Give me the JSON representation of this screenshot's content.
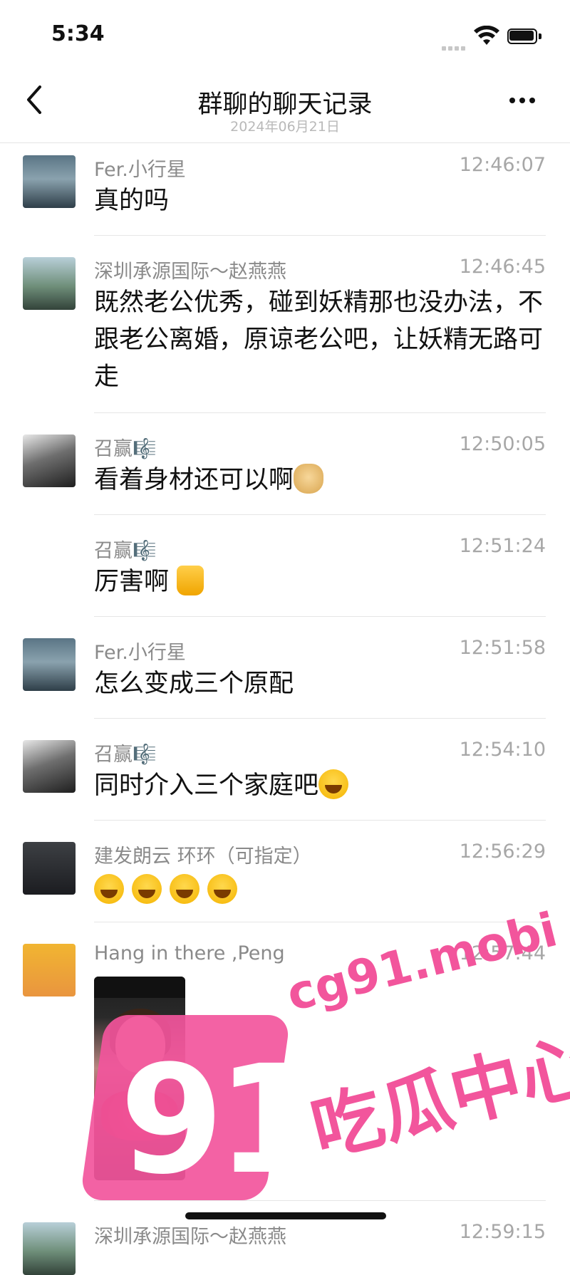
{
  "status_bar": {
    "time": "5:34"
  },
  "nav": {
    "title": "群聊的聊天记录",
    "subtitle": "2024年06月21日"
  },
  "messages": [
    {
      "sender": "Fer.小行星",
      "time": "12:46:07",
      "text": "真的吗",
      "avatar": "avatar-fer"
    },
    {
      "sender": "深圳承源国际～赵燕燕",
      "time": "12:46:45",
      "text": "既然老公优秀，碰到妖精那也没办法，不跟老公离婚，原谅老公吧，让妖精无路可走",
      "avatar": "avatar-shenzhen"
    },
    {
      "sender": "召赢🎼",
      "time": "12:50:05",
      "text": "看着身材还可以啊",
      "emoji": "doge-emoji",
      "avatar": "avatar-zhaoying"
    },
    {
      "sender": "召赢🎼",
      "time": "12:51:24",
      "text": "厉害啊",
      "emoji": "thumbs-up-emoji"
    },
    {
      "sender": "Fer.小行星",
      "time": "12:51:58",
      "text": "怎么变成三个原配",
      "avatar": "avatar-fer"
    },
    {
      "sender": "召赢🎼",
      "time": "12:54:10",
      "text": "同时介入三个家庭吧",
      "emoji": "laughing-emoji",
      "avatar": "avatar-zhaoying"
    },
    {
      "sender": "建发朗云 环环（可指定）",
      "time": "12:56:29",
      "text": "",
      "emoji": "laughing-emoji x4",
      "avatar": "avatar-jianfa"
    },
    {
      "sender": "Hang in there ,Peng",
      "time": "12:57:44",
      "text": "",
      "image": "shared-screenshot",
      "avatar": "avatar-hang"
    },
    {
      "sender": "深圳承源国际～赵燕燕",
      "time": "12:59:15",
      "text": "",
      "avatar": "avatar-shenzhen"
    }
  ],
  "watermark": {
    "number": "91",
    "domain": "cg91.mobi",
    "label": "吃瓜中心"
  }
}
